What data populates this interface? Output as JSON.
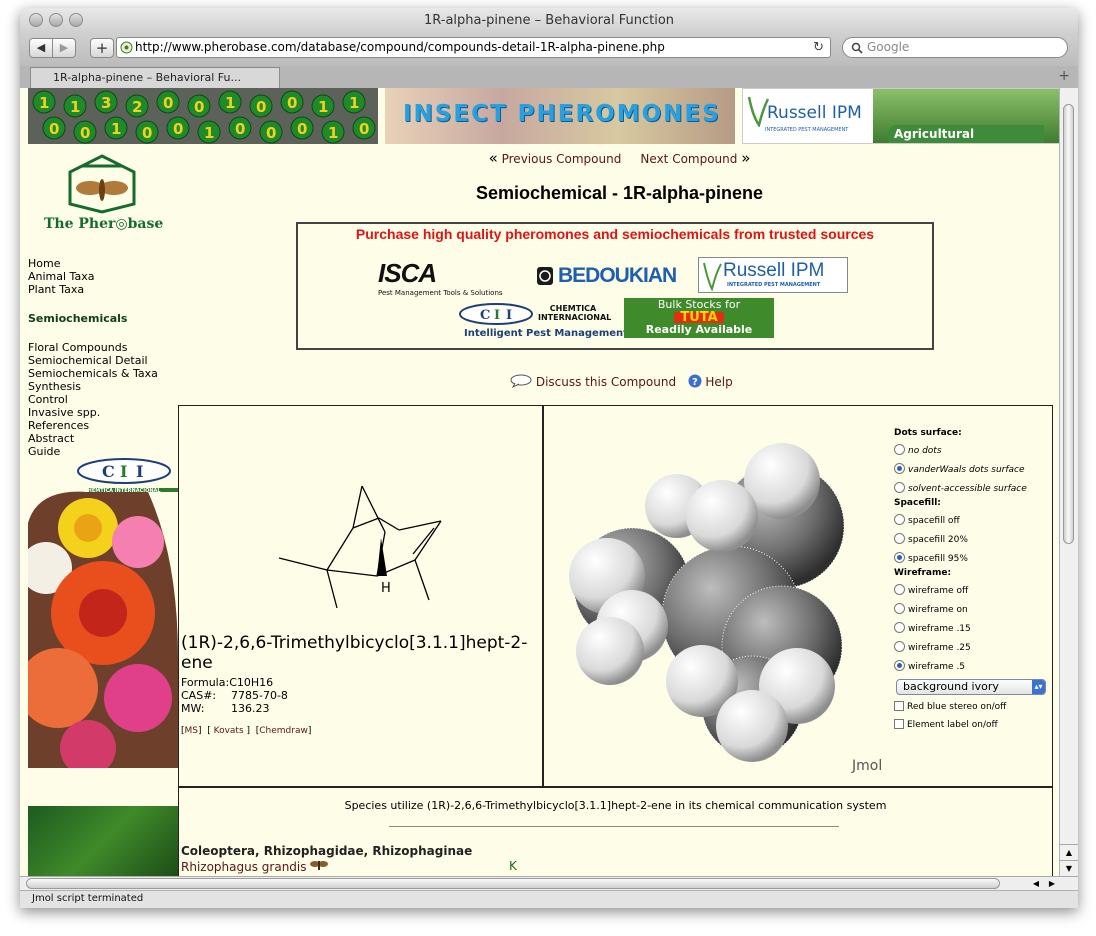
{
  "window": {
    "title": "1R-alpha-pinene – Behavioral Function"
  },
  "toolbar": {
    "back": "◀",
    "forward": "▶",
    "add": "+",
    "url": "http://www.pherobase.com/database/compound/compounds-detail-1R-alpha-pinene.php",
    "reload": "↻",
    "search_placeholder": "Google"
  },
  "tab": {
    "label": "1R-alpha-pinene – Behavioral Fu...",
    "add_tab": "+"
  },
  "banners": {
    "numbers_digits": [
      "1",
      "1",
      "3",
      "2",
      "0",
      "0",
      "1",
      "0",
      "0",
      "1",
      "1",
      "0",
      "0",
      "1",
      "0",
      "0",
      "1",
      "0",
      "0",
      "0",
      "1",
      "0"
    ],
    "insect_pheromones": "INSECT PHEROMONES",
    "russell_name": "Russell IPM",
    "russell_sub": "INTEGRATED PEST MANAGEMENT",
    "agricultural": "Agricultural"
  },
  "logo": {
    "text": "The Pher◎base"
  },
  "nav": {
    "items_top": [
      "Home",
      "Animal Taxa",
      "Plant Taxa"
    ],
    "section": "Semiochemicals",
    "items": [
      "Floral Compounds",
      "Semiochemical Detail",
      "Semiochemicals & Taxa",
      "Synthesis",
      "Control",
      "Invasive spp.",
      "References",
      "Abstract",
      "Guide"
    ]
  },
  "sidebar_ad": {
    "chemtica_label": "CHEMTICA INTERNACIONAL"
  },
  "compound_nav": {
    "prev": "Previous Compound",
    "next": "Next Compound",
    "prev_arrow": "«",
    "next_arrow": "»"
  },
  "heading": "Semiochemical - 1R-alpha-pinene",
  "purchase": {
    "headline": "Purchase high quality pheromones and semiochemicals from trusted sources",
    "isca": "ISCA",
    "isca_sub": "Pest Management Tools & Solutions",
    "bedoukian": "BEDOUKIAN",
    "russell": "Russell IPM",
    "russell_sub": "INTEGRATED PEST MANAGEMENT",
    "chemtica": "CHEMTICA INTERNACIONAL",
    "chemtica_sub": "Intelligent Pest Management",
    "bulk_line1": "Bulk Stocks for",
    "bulk_line2": "TUTA",
    "bulk_line3": "Readily Available"
  },
  "discuss": {
    "label": "Discuss this Compound",
    "help": "Help"
  },
  "compound": {
    "structure_h": "H",
    "name": "(1R)-2,6,6-Trimethylbicyclo[3.1.1]hept-2-ene",
    "formula_label": "Formula:",
    "formula": "C10H16",
    "cas_label": "CAS#:",
    "cas": "7785-70-8",
    "mw_label": "MW:",
    "mw": "136.23",
    "links": {
      "ms": "MS",
      "kovats": "Kovats",
      "chemdraw": "Chemdraw"
    }
  },
  "jmol": {
    "label": "Jmol",
    "dots_title": "Dots surface:",
    "dots": [
      {
        "label": "no dots",
        "on": false
      },
      {
        "label": "vanderWaals dots surface",
        "on": true
      },
      {
        "label": "solvent-accessible surface",
        "on": false
      }
    ],
    "spacefill_title": "Spacefill:",
    "spacefill": [
      {
        "label": "spacefill off",
        "on": false
      },
      {
        "label": "spacefill 20%",
        "on": false
      },
      {
        "label": "spacefill 95%",
        "on": true
      }
    ],
    "wireframe_title": "Wireframe:",
    "wireframe": [
      {
        "label": "wireframe off",
        "on": false
      },
      {
        "label": "wireframe on",
        "on": false
      },
      {
        "label": "wireframe .15",
        "on": false
      },
      {
        "label": "wireframe .25",
        "on": false
      },
      {
        "label": "wireframe .5",
        "on": true
      }
    ],
    "background_select": "background ivory",
    "checkboxes": [
      "Red blue stereo on/off",
      "Element label on/off"
    ]
  },
  "species": {
    "intro": "Species utilize (1R)-2,6,6-Trimethylbicyclo[3.1.1]hept-2-ene in its chemical communication system",
    "taxon": "Coleoptera, Rhizophagidae, Rhizophaginae",
    "genus": "Rhizophagus",
    "species": "grandis",
    "code": "K"
  },
  "status": "Jmol script terminated"
}
